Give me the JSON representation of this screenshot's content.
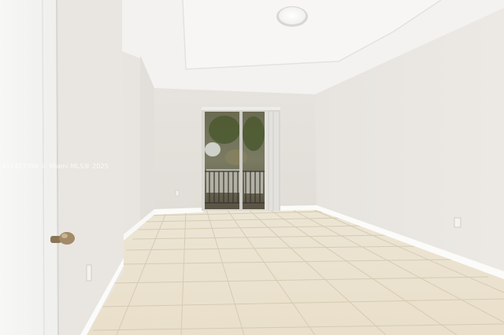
{
  "watermark": {
    "text": "A11827399 © Miami MLS® 2025"
  },
  "colors": {
    "wall_light": "#efedea",
    "wall_shade": "#dcd8d2",
    "ceiling": "#f4f3f1",
    "floor_tile": "#ebe2cf",
    "grout": "#d2c6ad",
    "baseboard": "#fbfbfa",
    "door": "#f5f5f4",
    "door_knob": "#9c8463",
    "glass_dark": "#4a4134",
    "foliage": "#5d6a3c"
  }
}
